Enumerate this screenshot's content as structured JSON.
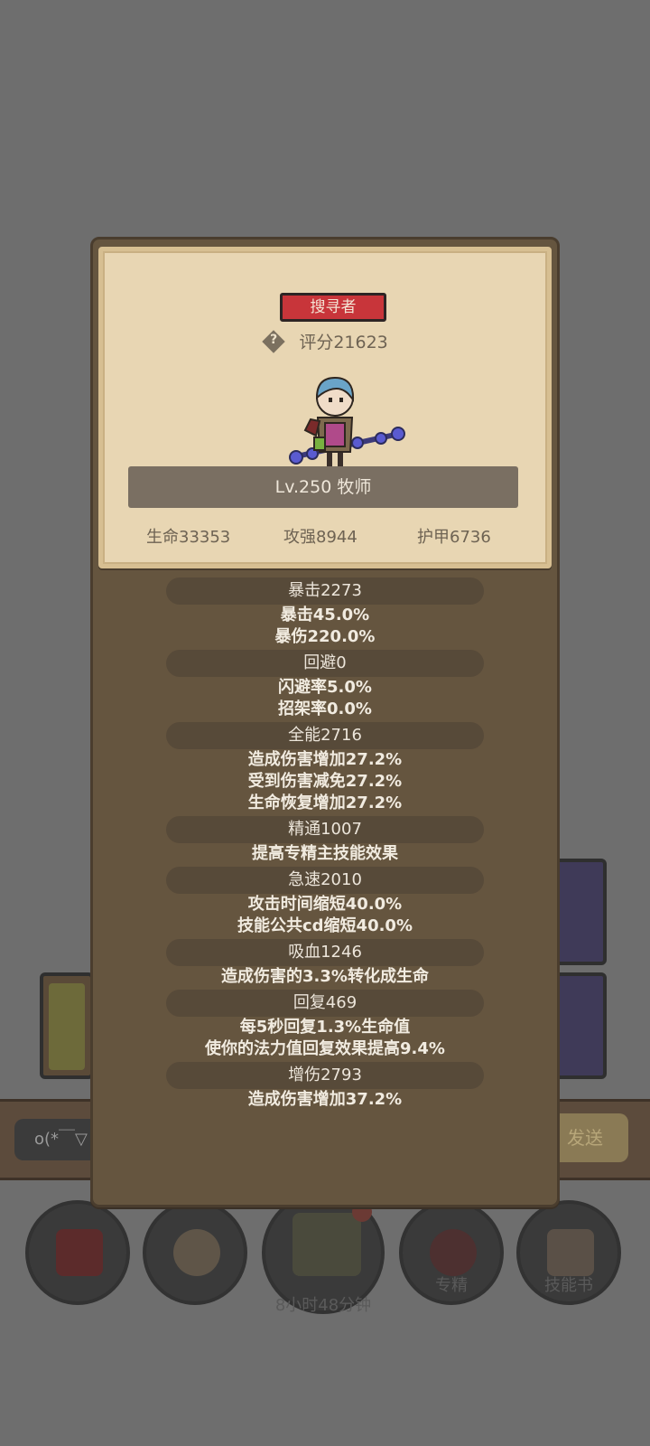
{
  "background": {
    "chat_placeholder": "o(*￣▽",
    "send_label": "发送",
    "nav": [
      {
        "icon": "potion-icon",
        "label": ""
      },
      {
        "icon": "bread-icon",
        "label": ""
      },
      {
        "icon": "treasure-chest-icon",
        "label": ""
      },
      {
        "icon": "mastery-icon",
        "label": "专精"
      },
      {
        "icon": "skill-book-icon",
        "label": "技能书"
      }
    ],
    "timer": "8小时48分钟"
  },
  "character": {
    "rank_badge": "搜寻者",
    "score": "评分21623",
    "level_class": "Lv.250 牧师",
    "base_stats": [
      "生命33353",
      "攻强8944",
      "护甲6736"
    ]
  },
  "stats": [
    {
      "header": "暴击2273",
      "details": [
        "暴击45.0%",
        "暴伤220.0%"
      ]
    },
    {
      "header": "回避0",
      "details": [
        "闪避率5.0%",
        "招架率0.0%"
      ]
    },
    {
      "header": "全能2716",
      "details": [
        "造成伤害增加27.2%",
        "受到伤害减免27.2%",
        "生命恢复增加27.2%"
      ]
    },
    {
      "header": "精通1007",
      "details": [
        "提高专精主技能效果"
      ]
    },
    {
      "header": "急速2010",
      "details": [
        "攻击时间缩短40.0%",
        "技能公共cd缩短40.0%"
      ]
    },
    {
      "header": "吸血1246",
      "details": [
        "造成伤害的3.3%转化成生命"
      ]
    },
    {
      "header": "回复469",
      "details": [
        "每5秒回复1.3%生命值",
        "使你的法力值回复效果提高9.4%"
      ]
    },
    {
      "header": "增伤2793",
      "details": [
        "造成伤害增加37.2%"
      ]
    }
  ],
  "colors": {
    "panel": "#65553f",
    "parchment": "#e8d6b3",
    "badge": "#c8353a",
    "stat_header": "#574a39"
  }
}
